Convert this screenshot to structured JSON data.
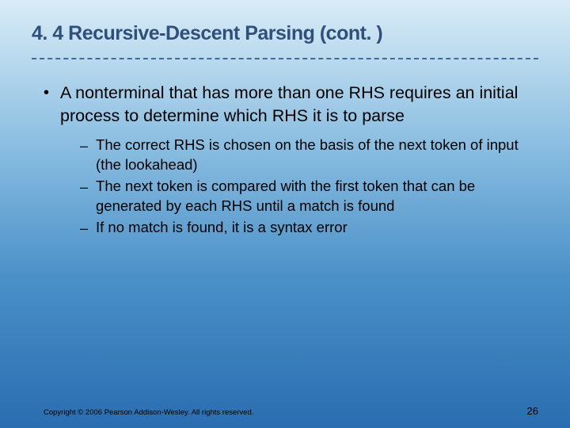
{
  "title": "4. 4 Recursive-Descent Parsing (cont. )",
  "main_bullet": "A nonterminal that has more than one RHS requires an initial process to determine which RHS it is to parse",
  "sub_bullets": [
    "The correct RHS is chosen on the basis of the next token of input (the lookahead)",
    "The next token is compared with the first token that can be generated by each RHS until a match is found",
    "If no match is found, it is a syntax error"
  ],
  "copyright": "Copyright © 2006 Pearson Addison-Wesley. All rights reserved.",
  "page_number": "26"
}
